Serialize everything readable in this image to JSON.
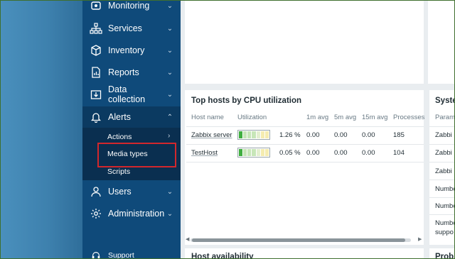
{
  "sidebar": {
    "items": [
      {
        "label": "Monitoring",
        "icon": "eye-icon",
        "chevron": "chevron-down"
      },
      {
        "label": "Services",
        "icon": "sitemap-icon",
        "chevron": "chevron-down"
      },
      {
        "label": "Inventory",
        "icon": "cube-icon",
        "chevron": "chevron-down"
      },
      {
        "label": "Reports",
        "icon": "report-icon",
        "chevron": "chevron-down"
      },
      {
        "label": "Data collection",
        "icon": "download-icon",
        "chevron": "chevron-down"
      },
      {
        "label": "Alerts",
        "icon": "bell-icon",
        "chevron": "chevron-up"
      },
      {
        "label": "Users",
        "icon": "user-icon",
        "chevron": "chevron-down"
      },
      {
        "label": "Administration",
        "icon": "gear-icon",
        "chevron": "chevron-down"
      }
    ],
    "alerts_submenu": [
      {
        "label": "Actions"
      },
      {
        "label": "Media types"
      },
      {
        "label": "Scripts"
      }
    ],
    "support_label": "Support"
  },
  "widgets": {
    "cpu": {
      "title": "Top hosts by CPU utilization",
      "columns": [
        "Host name",
        "Utilization",
        "1m avg",
        "5m avg",
        "15m avg",
        "Processes"
      ],
      "rows": [
        {
          "host": "Zabbix server",
          "util_pct": "1.26 %",
          "util_fraction": 0.0126,
          "avg1": "0.00",
          "avg5": "0.00",
          "avg15": "0.00",
          "processes": "185"
        },
        {
          "host": "TestHost",
          "util_pct": "0.05 %",
          "util_fraction": 0.0005,
          "avg1": "0.00",
          "avg5": "0.00",
          "avg15": "0.00",
          "processes": "104"
        }
      ]
    },
    "system": {
      "title_partial": "Syste",
      "header_partial": "Param",
      "rows_partial": [
        "Zabbi",
        "Zabbi",
        "Zabbi",
        "Numbe",
        "Numbe",
        "Numbe",
        "suppo"
      ]
    },
    "host_availability": {
      "title_partial": "Host availability"
    },
    "problems": {
      "title_partial": "Probl"
    }
  },
  "colors": {
    "sidebar_bg": "#0f4a7a",
    "submenu_bg": "#0a2f50",
    "highlight": "#d2272c",
    "util_green": "#3fae3f",
    "util_light_green": "#c7e6b8",
    "util_yellow": "#f5ecb0"
  }
}
